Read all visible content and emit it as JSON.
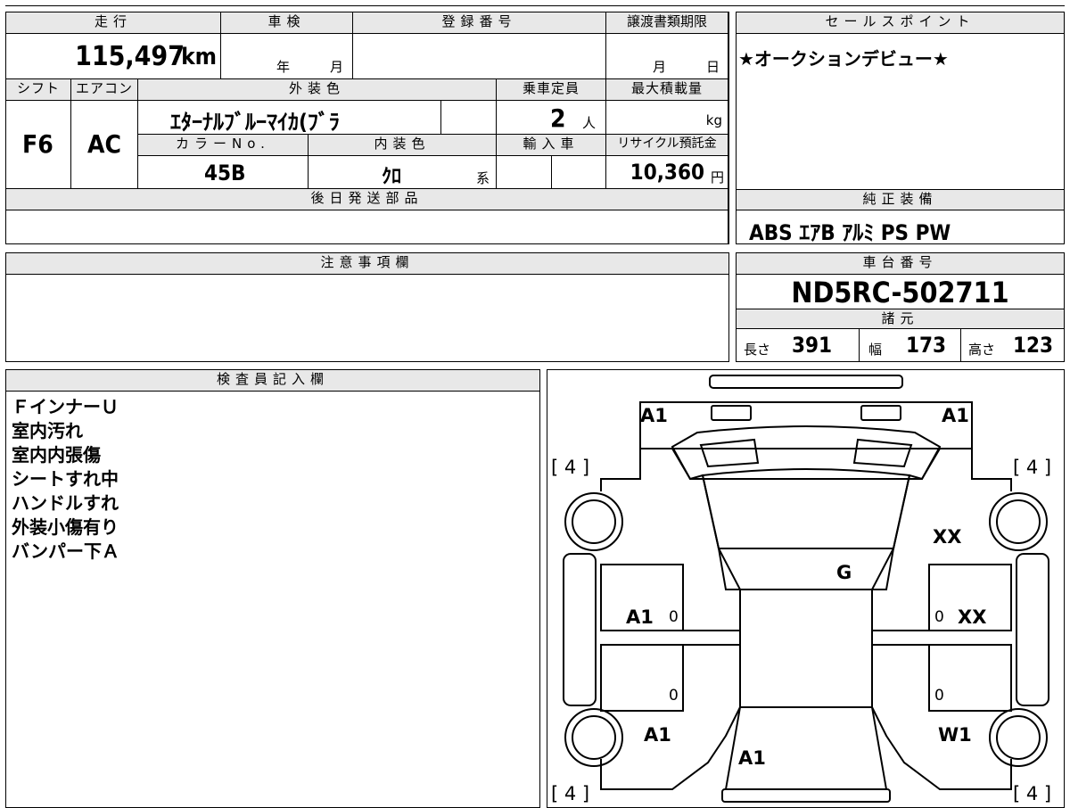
{
  "header": {
    "mileage_label": "走行",
    "inspection_label": "車検",
    "registration_label": "登録番号",
    "transfer_deadline_label": "譲渡書類期限",
    "sales_point_label": "セールスポイント"
  },
  "mileage": {
    "value": "115,497",
    "unit": "km"
  },
  "inspection": {
    "year_unit": "年",
    "month_unit": "月"
  },
  "transfer_deadline": {
    "month_unit": "月",
    "day_unit": "日"
  },
  "sales_point": {
    "text": "★オークションデビュー★"
  },
  "labels": {
    "shift": "シフト",
    "aircon": "エアコン",
    "exterior_color": "外装色",
    "capacity": "乗車定員",
    "max_load": "最大積載量",
    "color_no": "カラーNo.",
    "interior_color": "内装色",
    "import": "輸入車",
    "recycle": "リサイクル預託金",
    "later_parts": "後日発送部品",
    "equipment": "純正装備",
    "notes": "注意事項欄",
    "chassis": "車台番号",
    "specs": "諸元",
    "inspector": "検査員記入欄"
  },
  "values": {
    "shift": "F6",
    "aircon": "AC",
    "exterior_color": "ｴﾀｰﾅﾙﾌﾞﾙｰﾏｲｶ(ﾌﾞﾗ",
    "capacity": "2",
    "capacity_unit": "人",
    "max_load_unit": "kg",
    "color_no": "45B",
    "interior_color": "ｸﾛ",
    "interior_suffix": "系",
    "recycle": "10,360",
    "recycle_unit": "円"
  },
  "equipment": {
    "text": "ABS ｴｱB ｱﾙﾐ PS PW"
  },
  "chassis": {
    "number": "ND5RC-502711"
  },
  "specs": {
    "length_label": "長さ",
    "length": "391",
    "width_label": "幅",
    "width": "173",
    "height_label": "高さ",
    "height": "123"
  },
  "inspector_notes": [
    "ＦインナーＵ",
    "室内汚れ",
    "室内内張傷",
    "シートすれ中",
    "ハンドルすれ",
    "外装小傷有り",
    "バンパー下Ａ"
  ],
  "diagram": {
    "marks": {
      "front_left": "A1",
      "front_right": "A1",
      "tire_fl": "[ 4 ]",
      "tire_fr": "[ 4 ]",
      "tire_rl": "[ 4 ]",
      "tire_rr": "[ 4 ]",
      "fender_fr": "XX",
      "windshield": "G",
      "door_left": "A1",
      "door_left_zero": "0",
      "door_right_zero": "0",
      "door_right": "XX",
      "rear_left_zero": "0",
      "rear_right_zero": "0",
      "quarter_left": "A1",
      "quarter_right": "W1",
      "trunk": "A1"
    }
  }
}
